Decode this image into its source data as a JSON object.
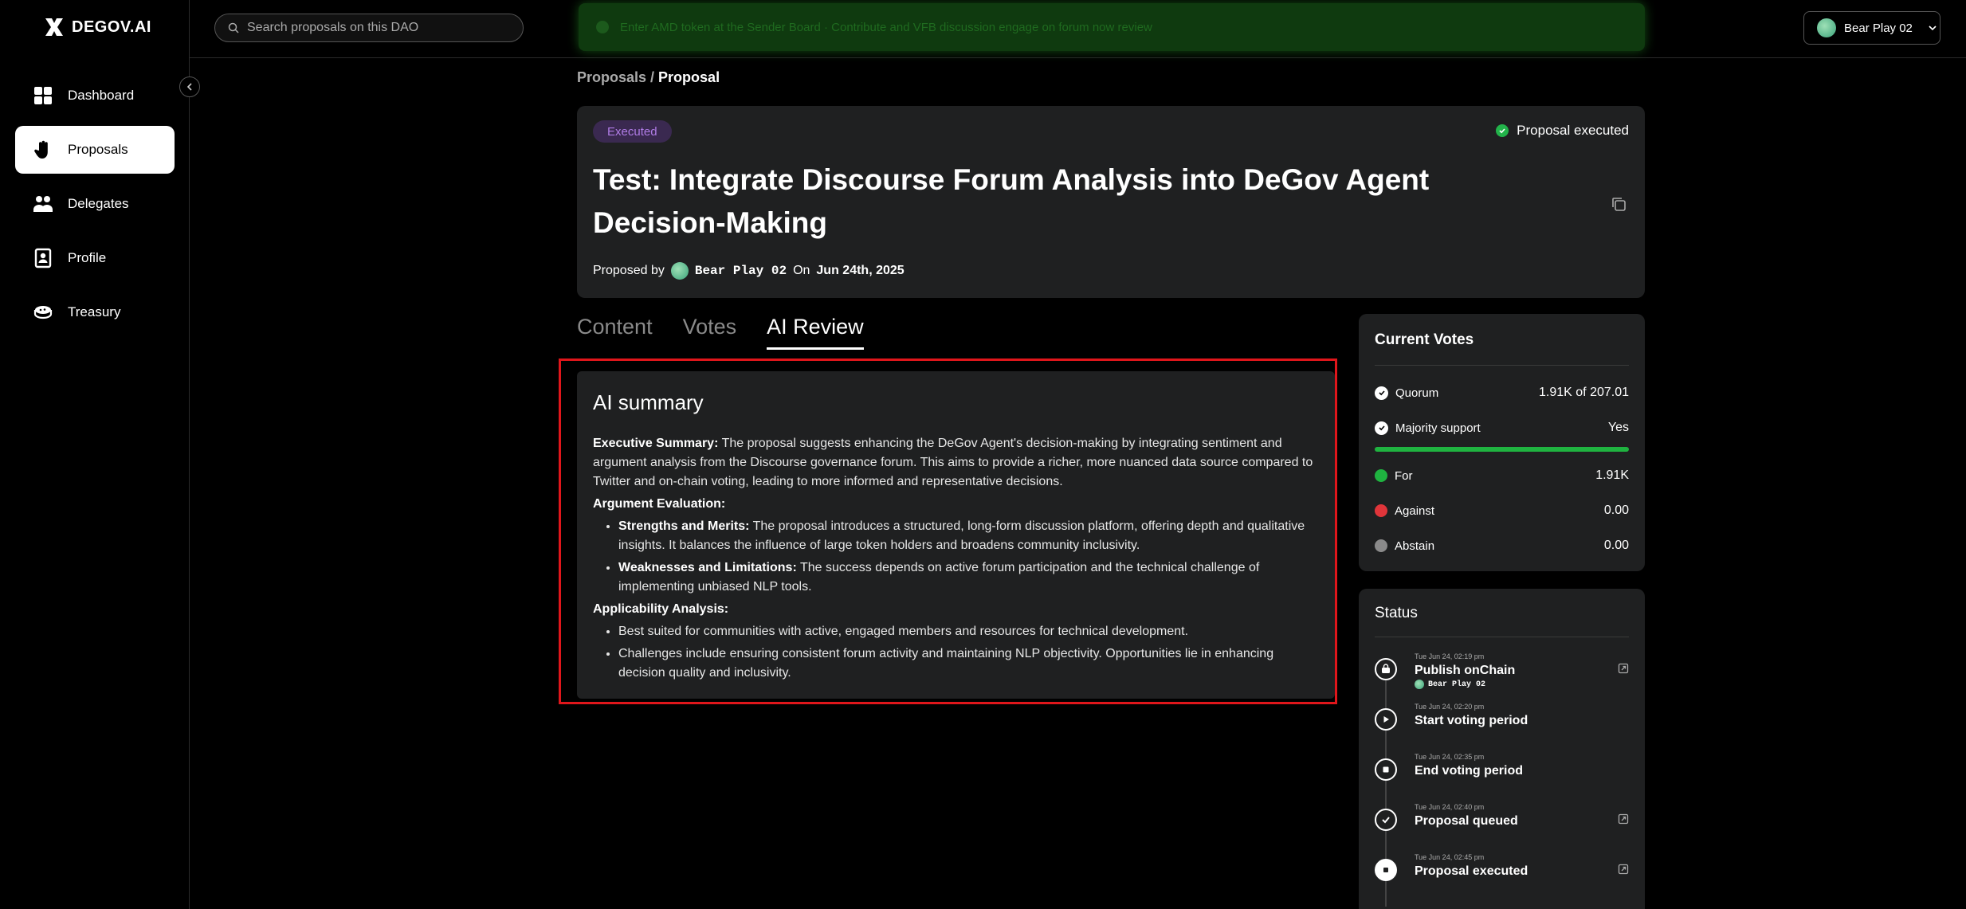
{
  "brand": {
    "name": "DEGOV.AI"
  },
  "sidebar": {
    "items": [
      {
        "label": "Dashboard",
        "icon": "dashboard-icon",
        "active": false
      },
      {
        "label": "Proposals",
        "icon": "hand-icon",
        "active": true
      },
      {
        "label": "Delegates",
        "icon": "people-icon",
        "active": false
      },
      {
        "label": "Profile",
        "icon": "profile-icon",
        "active": false
      },
      {
        "label": "Treasury",
        "icon": "treasury-icon",
        "active": false
      }
    ]
  },
  "topbar": {
    "search_placeholder": "Search proposals on this DAO",
    "banner_text": "Enter AMD token at the Sender Board · Contribute and VFB discussion engage on forum now review",
    "user_name": "Bear Play 02"
  },
  "breadcrumb": {
    "parent": "Proposals",
    "separator": " / ",
    "current": "Proposal"
  },
  "proposal": {
    "badge": "Executed",
    "status_text": "Proposal executed",
    "title": "Test: Integrate Discourse Forum Analysis into DeGov Agent Decision-Making",
    "proposed_by_label": "Proposed by",
    "author": "Bear Play 02",
    "on_label": "On",
    "date": "Jun 24th, 2025"
  },
  "tabs": [
    {
      "label": "Content",
      "active": false
    },
    {
      "label": "Votes",
      "active": false
    },
    {
      "label": "AI Review",
      "active": true
    }
  ],
  "ai_summary": {
    "heading": "AI summary",
    "exec_label": "Executive Summary:",
    "exec_text": " The proposal suggests enhancing the DeGov Agent's decision-making by integrating sentiment and argument analysis from the Discourse governance forum. This aims to provide a richer, more nuanced data source compared to Twitter and on-chain voting, leading to more informed and representative decisions.",
    "argument_label": "Argument Evaluation:",
    "strengths_label": "Strengths and Merits:",
    "strengths_text": " The proposal introduces a structured, long-form discussion platform, offering depth and qualitative insights. It balances the influence of large token holders and broadens community inclusivity.",
    "weaknesses_label": "Weaknesses and Limitations:",
    "weaknesses_text": " The success depends on active forum participation and the technical challenge of implementing unbiased NLP tools.",
    "applicability_label": "Applicability Analysis:",
    "applicability_1": "Best suited for communities with active, engaged members and resources for technical development.",
    "applicability_2": "Challenges include ensuring consistent forum activity and maintaining NLP objectivity. Opportunities lie in enhancing decision quality and inclusivity."
  },
  "votes": {
    "title": "Current Votes",
    "quorum_label": "Quorum",
    "quorum_value": "1.91K of 207.01",
    "majority_label": "Majority support",
    "majority_value": "Yes",
    "support_fraction": 1.0,
    "for_label": "For",
    "for_value": "1.91K",
    "against_label": "Against",
    "against_value": "0.00",
    "abstain_label": "Abstain",
    "abstain_value": "0.00",
    "colors": {
      "for": "#1fb340",
      "against": "#e0353a",
      "abstain": "#8a8a8a"
    }
  },
  "status": {
    "title": "Status",
    "steps": [
      {
        "time": "Tue Jun 24, 02:19 pm",
        "label": "Publish onChain",
        "sub": "Bear Play 02",
        "icon": "upload-icon"
      },
      {
        "time": "Tue Jun 24, 02:20 pm",
        "label": "Start voting period",
        "icon": "play-icon"
      },
      {
        "time": "Tue Jun 24, 02:35 pm",
        "label": "End voting period",
        "icon": "stop-icon"
      },
      {
        "time": "Tue Jun 24, 02:40 pm",
        "label": "Proposal queued",
        "icon": "check-icon"
      },
      {
        "time": "Tue Jun 24, 02:45 pm",
        "label": "Proposal executed",
        "icon": "flag-icon"
      }
    ]
  }
}
